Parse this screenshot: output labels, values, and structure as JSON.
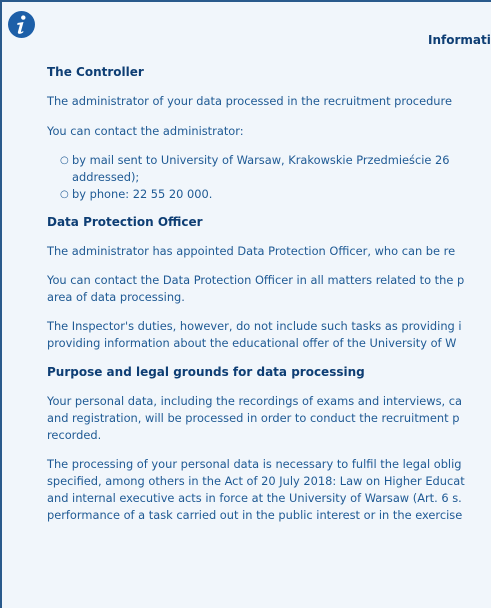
{
  "header": {
    "title": "Informati",
    "icon": "info-icon",
    "icon_color": "#1d5fa8",
    "border_color": "#2a5a8c"
  },
  "sections": {
    "controller": {
      "heading": "The Controller",
      "p1": "The administrator of your data processed in the recruitment procedure",
      "p2": "You can contact the administrator:",
      "bullet1_line1": "by mail sent to University of Warsaw, Krakowskie Przedmieście 26",
      "bullet1_line2": "addressed);",
      "bullet2": "by phone: 22 55 20 000."
    },
    "dpo": {
      "heading": "Data Protection Officer",
      "p1": "The administrator has appointed Data Protection Officer, who can be re",
      "p2_line1": "You can contact the Data Protection Officer in all matters related to the p",
      "p2_line2": "area of data processing.",
      "p3_line1": "The Inspector's duties, however, do not include such tasks as providing i",
      "p3_line2": "providing information about the educational offer of the University of W"
    },
    "purpose": {
      "heading": "Purpose and legal grounds for data processing",
      "p1_line1": "Your personal data, including the recordings of exams and interviews, ca",
      "p1_line2": "and registration, will be processed in order to conduct the recruitment p",
      "p1_line3": "recorded.",
      "p2_line1": "The processing of your personal data is necessary to fulfil the legal oblig",
      "p2_line2": "specified, among others in the Act of 20 July 2018: Law on Higher Educat",
      "p2_line3": "and internal executive acts in force at the University of Warsaw (Art. 6 s.",
      "p2_line4": "performance of a task carried out in the public interest or in the exercise"
    }
  }
}
